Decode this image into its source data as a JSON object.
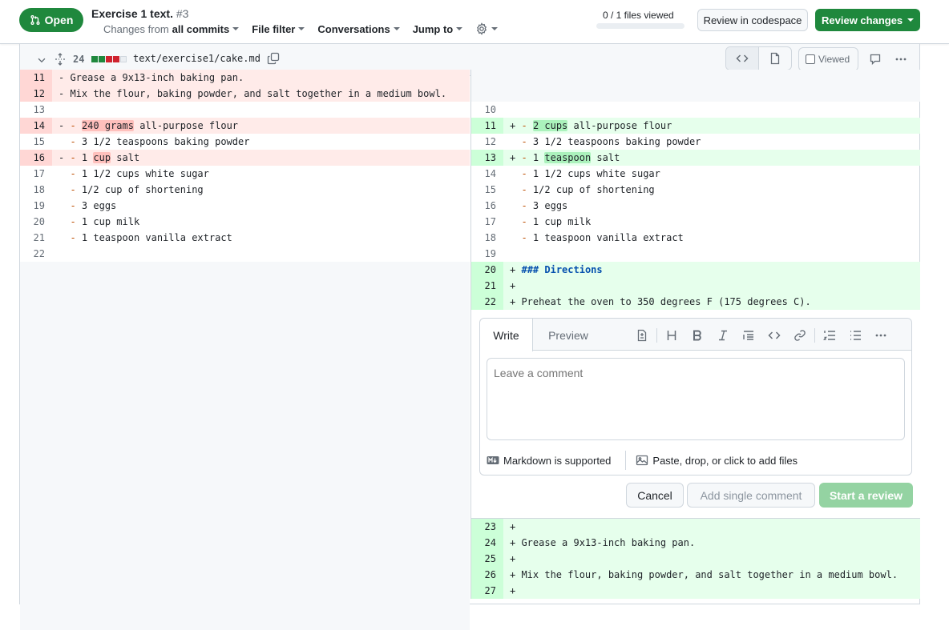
{
  "header": {
    "state_label": "Open",
    "title": "Exercise 1 text.",
    "number": "#3",
    "changes_from_prefix": "Changes from",
    "changes_from_value": "all commits",
    "file_filter": "File filter",
    "conversations": "Conversations",
    "jump_to": "Jump to",
    "files_viewed": "0 / 1 files viewed",
    "files_viewed_progress": 0,
    "review_in_codespace": "Review in codespace",
    "review_changes": "Review changes"
  },
  "file": {
    "changed_lines": "24",
    "diffstat": [
      "add",
      "add",
      "del",
      "del",
      "neutral"
    ],
    "path": "text/exercise1/cake.md",
    "viewed_label": "Viewed",
    "viewed_checked": false
  },
  "colors": {
    "add": "#1f883d",
    "del": "#cf222e",
    "neutral": "#eaeef2"
  },
  "left_rows": [
    {
      "ln": "11",
      "type": "del",
      "sign": "-",
      "segments": [
        {
          "t": " Grease a 9x13-inch baking pan."
        }
      ]
    },
    {
      "ln": "12",
      "type": "del",
      "sign": "-",
      "segments": [
        {
          "t": " Mix the flour, baking powder, and salt together in a medium bowl."
        }
      ]
    },
    {
      "ln": "13",
      "type": "ctx",
      "sign": " ",
      "segments": []
    },
    {
      "ln": "14",
      "type": "del",
      "sign": "-",
      "segments": [
        {
          "t": " "
        },
        {
          "t": "-",
          "c": "mk"
        },
        {
          "t": " "
        },
        {
          "t": "240 grams",
          "c": "hl-del"
        },
        {
          "t": " all-purpose flour"
        }
      ]
    },
    {
      "ln": "15",
      "type": "ctx",
      "sign": " ",
      "segments": [
        {
          "t": " "
        },
        {
          "t": "-",
          "c": "mk"
        },
        {
          "t": " 3 1/2 teaspoons baking powder"
        }
      ]
    },
    {
      "ln": "16",
      "type": "del",
      "sign": "-",
      "segments": [
        {
          "t": " "
        },
        {
          "t": "-",
          "c": "mk"
        },
        {
          "t": " 1 "
        },
        {
          "t": "cup",
          "c": "hl-del"
        },
        {
          "t": " salt"
        }
      ]
    },
    {
      "ln": "17",
      "type": "ctx",
      "sign": " ",
      "segments": [
        {
          "t": " "
        },
        {
          "t": "-",
          "c": "mk"
        },
        {
          "t": " 1 1/2 cups white sugar"
        }
      ]
    },
    {
      "ln": "18",
      "type": "ctx",
      "sign": " ",
      "segments": [
        {
          "t": " "
        },
        {
          "t": "-",
          "c": "mk"
        },
        {
          "t": " 1/2 cup of shortening"
        }
      ]
    },
    {
      "ln": "19",
      "type": "ctx",
      "sign": " ",
      "segments": [
        {
          "t": " "
        },
        {
          "t": "-",
          "c": "mk"
        },
        {
          "t": " 3 eggs"
        }
      ]
    },
    {
      "ln": "20",
      "type": "ctx",
      "sign": " ",
      "segments": [
        {
          "t": " "
        },
        {
          "t": "-",
          "c": "mk"
        },
        {
          "t": " 1 cup milk"
        }
      ]
    },
    {
      "ln": "21",
      "type": "ctx",
      "sign": " ",
      "segments": [
        {
          "t": " "
        },
        {
          "t": "-",
          "c": "mk"
        },
        {
          "t": " 1 teaspoon vanilla extract"
        }
      ]
    },
    {
      "ln": "22",
      "type": "ctx",
      "sign": " ",
      "segments": []
    }
  ],
  "right_rows_top": [
    {
      "ln": "",
      "type": "empty",
      "sign": "",
      "segments": []
    },
    {
      "ln": "",
      "type": "empty",
      "sign": "",
      "segments": []
    },
    {
      "ln": "10",
      "type": "ctx",
      "sign": " ",
      "segments": []
    },
    {
      "ln": "11",
      "type": "add",
      "sign": "+",
      "segments": [
        {
          "t": " "
        },
        {
          "t": "-",
          "c": "mk"
        },
        {
          "t": " "
        },
        {
          "t": "2 cups",
          "c": "hl-add"
        },
        {
          "t": " all-purpose flour"
        }
      ]
    },
    {
      "ln": "12",
      "type": "ctx",
      "sign": " ",
      "segments": [
        {
          "t": " "
        },
        {
          "t": "-",
          "c": "mk"
        },
        {
          "t": " 3 1/2 teaspoons baking powder"
        }
      ]
    },
    {
      "ln": "13",
      "type": "add",
      "sign": "+",
      "segments": [
        {
          "t": " "
        },
        {
          "t": "-",
          "c": "mk"
        },
        {
          "t": " 1 "
        },
        {
          "t": "teaspoon",
          "c": "hl-add"
        },
        {
          "t": " salt"
        }
      ]
    },
    {
      "ln": "14",
      "type": "ctx",
      "sign": " ",
      "segments": [
        {
          "t": " "
        },
        {
          "t": "-",
          "c": "mk"
        },
        {
          "t": " 1 1/2 cups white sugar"
        }
      ]
    },
    {
      "ln": "15",
      "type": "ctx",
      "sign": " ",
      "segments": [
        {
          "t": " "
        },
        {
          "t": "-",
          "c": "mk"
        },
        {
          "t": " 1/2 cup of shortening"
        }
      ]
    },
    {
      "ln": "16",
      "type": "ctx",
      "sign": " ",
      "segments": [
        {
          "t": " "
        },
        {
          "t": "-",
          "c": "mk"
        },
        {
          "t": " 3 eggs"
        }
      ]
    },
    {
      "ln": "17",
      "type": "ctx",
      "sign": " ",
      "segments": [
        {
          "t": " "
        },
        {
          "t": "-",
          "c": "mk"
        },
        {
          "t": " 1 cup milk"
        }
      ]
    },
    {
      "ln": "18",
      "type": "ctx",
      "sign": " ",
      "segments": [
        {
          "t": " "
        },
        {
          "t": "-",
          "c": "mk"
        },
        {
          "t": " 1 teaspoon vanilla extract"
        }
      ]
    },
    {
      "ln": "19",
      "type": "ctx",
      "sign": " ",
      "segments": []
    },
    {
      "ln": "20",
      "type": "add",
      "sign": "+",
      "segments": [
        {
          "t": " "
        },
        {
          "t": "### Directions",
          "c": "hdr"
        }
      ]
    },
    {
      "ln": "21",
      "type": "add",
      "sign": "+",
      "segments": []
    },
    {
      "ln": "22",
      "type": "add",
      "sign": "+",
      "segments": [
        {
          "t": " Preheat the oven to 350 degrees F (175 degrees C)."
        }
      ]
    }
  ],
  "right_rows_bottom": [
    {
      "ln": "23",
      "type": "add",
      "sign": "+",
      "segments": []
    },
    {
      "ln": "24",
      "type": "add",
      "sign": "+",
      "segments": [
        {
          "t": " Grease a 9x13-inch baking pan."
        }
      ]
    },
    {
      "ln": "25",
      "type": "add",
      "sign": "+",
      "segments": []
    },
    {
      "ln": "26",
      "type": "add",
      "sign": "+",
      "segments": [
        {
          "t": " Mix the flour, baking powder, and salt together in a medium bowl."
        }
      ]
    },
    {
      "ln": "27",
      "type": "add",
      "sign": "+",
      "segments": []
    }
  ],
  "comment": {
    "tab_write": "Write",
    "tab_preview": "Preview",
    "placeholder": "Leave a comment",
    "value": "",
    "markdown_note": "Markdown is supported",
    "attach_note": "Paste, drop, or click to add files",
    "cancel": "Cancel",
    "add_single": "Add single comment",
    "start_review": "Start a review"
  }
}
